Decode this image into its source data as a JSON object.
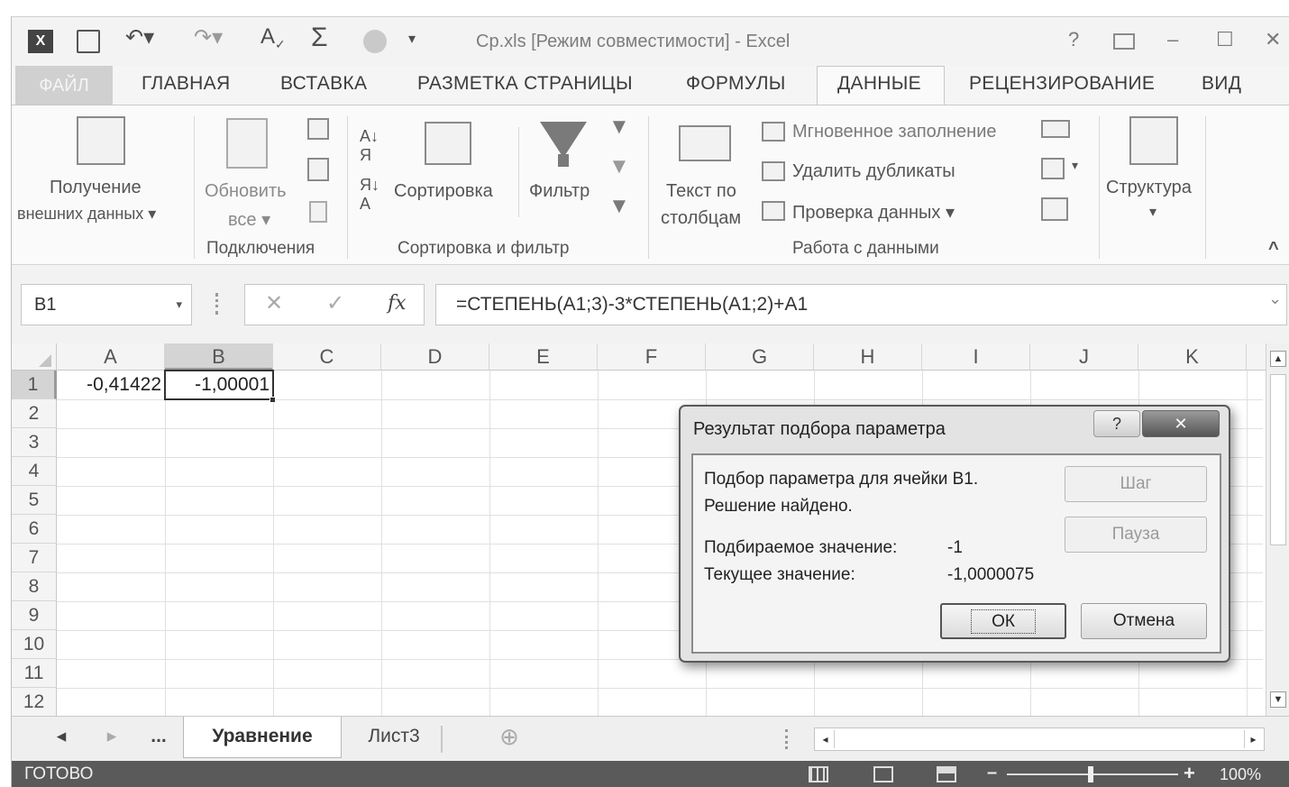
{
  "window": {
    "title": "Ср.xls  [Режим совместимости] - Excel",
    "help_label": "?",
    "minimize_label": "–",
    "maximize_label": "☐",
    "close_label": "✕"
  },
  "ribbon_tabs": {
    "file": "ФАЙЛ",
    "home": "ГЛАВНАЯ",
    "insert": "ВСТАВКА",
    "page_layout": "РАЗМЕТКА СТРАНИЦЫ",
    "formulas": "ФОРМУЛЫ",
    "data": "ДАННЫЕ",
    "review": "РЕЦЕНЗИРОВАНИЕ",
    "view": "ВИД",
    "active": "ДАННЫЕ"
  },
  "ribbon": {
    "get_external_line1": "Получение",
    "get_external_line2": "внешних данных ▾",
    "refresh_line1": "Обновить",
    "refresh_line2": "все ▾",
    "sort": "Сортировка",
    "filter": "Фильтр",
    "text_to_cols_line1": "Текст по",
    "text_to_cols_line2": "столбцам",
    "flash_fill": "Мгновенное заполнение",
    "remove_duplicates": "Удалить дубликаты",
    "data_validation": "Проверка данных  ▾",
    "outline_line1": "Структура",
    "outline_line2": "▾",
    "group_connections": "Подключения",
    "group_sort_filter": "Сортировка и фильтр",
    "group_data_tools": "Работа с данными",
    "collapse": "^"
  },
  "formula_bar": {
    "name_box": "B1",
    "name_box_dropdown": "▾",
    "fx": "fx",
    "cancel": "✕",
    "enter": "✓",
    "formula": "=СТЕПЕНЬ(A1;3)-3*СТЕПЕНЬ(A1;2)+A1",
    "expand": "⌄"
  },
  "grid": {
    "columns": [
      "A",
      "B",
      "C",
      "D",
      "E",
      "F",
      "G",
      "H",
      "I",
      "J",
      "K"
    ],
    "rows": [
      "1",
      "2",
      "3",
      "4",
      "5",
      "6",
      "7",
      "8",
      "9",
      "10",
      "11",
      "12"
    ],
    "selected_column": "B",
    "selected_row": "1",
    "cells": {
      "A1": "-0,41422",
      "B1": "-1,00001"
    }
  },
  "sheets": {
    "prev": "◂",
    "next": "▸",
    "more": "...",
    "tabs": [
      "Уравнение",
      "Лист3"
    ],
    "active": "Уравнение",
    "add": "⊕"
  },
  "status": {
    "mode": "ГОТОВО",
    "zoom": "100%",
    "zoom_minus": "–",
    "zoom_plus": "+"
  },
  "dialog": {
    "title": "Результат подбора параметра",
    "help_label": "?",
    "close_label": "✕",
    "line1": "Подбор параметра для ячейки B1.",
    "line2": "Решение найдено.",
    "target_label": "Подбираемое значение:",
    "target_value": "-1",
    "current_label": "Текущее значение:",
    "current_value": "-1,0000075",
    "step_button": "Шаг",
    "pause_button": "Пауза",
    "ok_button": "ОК",
    "cancel_button": "Отмена"
  }
}
